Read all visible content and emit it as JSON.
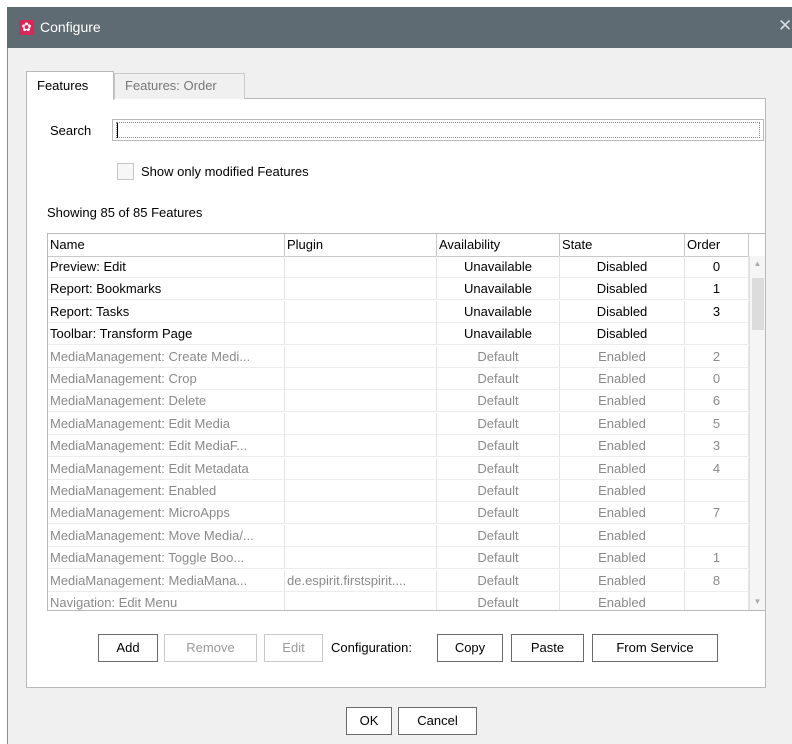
{
  "window": {
    "title": "Configure",
    "close_glyph": "✕"
  },
  "tabs": [
    {
      "label": "Features"
    },
    {
      "label": "Features: Order"
    }
  ],
  "search": {
    "label": "Search",
    "value": ""
  },
  "filter": {
    "label": "Show only modified Features",
    "checked": false
  },
  "status": "Showing 85 of 85 Features",
  "table": {
    "columns": [
      "Name",
      "Plugin",
      "Availability",
      "State",
      "Order"
    ],
    "rows": [
      {
        "name": "Preview: Edit",
        "plugin": "",
        "availability": "Unavailable",
        "state": "Disabled",
        "order": "0",
        "modified": true
      },
      {
        "name": "Report: Bookmarks",
        "plugin": "",
        "availability": "Unavailable",
        "state": "Disabled",
        "order": "1",
        "modified": true
      },
      {
        "name": "Report: Tasks",
        "plugin": "",
        "availability": "Unavailable",
        "state": "Disabled",
        "order": "3",
        "modified": true
      },
      {
        "name": "Toolbar: Transform Page",
        "plugin": "",
        "availability": "Unavailable",
        "state": "Disabled",
        "order": "",
        "modified": true
      },
      {
        "name": "MediaManagement: Create Medi...",
        "plugin": "",
        "availability": "Default",
        "state": "Enabled",
        "order": "2",
        "modified": false
      },
      {
        "name": "MediaManagement: Crop",
        "plugin": "",
        "availability": "Default",
        "state": "Enabled",
        "order": "0",
        "modified": false
      },
      {
        "name": "MediaManagement: Delete",
        "plugin": "",
        "availability": "Default",
        "state": "Enabled",
        "order": "6",
        "modified": false
      },
      {
        "name": "MediaManagement: Edit Media",
        "plugin": "",
        "availability": "Default",
        "state": "Enabled",
        "order": "5",
        "modified": false
      },
      {
        "name": "MediaManagement: Edit MediaF...",
        "plugin": "",
        "availability": "Default",
        "state": "Enabled",
        "order": "3",
        "modified": false
      },
      {
        "name": "MediaManagement: Edit Metadata",
        "plugin": "",
        "availability": "Default",
        "state": "Enabled",
        "order": "4",
        "modified": false
      },
      {
        "name": "MediaManagement: Enabled",
        "plugin": "",
        "availability": "Default",
        "state": "Enabled",
        "order": "",
        "modified": false
      },
      {
        "name": "MediaManagement: MicroApps",
        "plugin": "",
        "availability": "Default",
        "state": "Enabled",
        "order": "7",
        "modified": false
      },
      {
        "name": "MediaManagement: Move Media/...",
        "plugin": "",
        "availability": "Default",
        "state": "Enabled",
        "order": "",
        "modified": false
      },
      {
        "name": "MediaManagement: Toggle Boo...",
        "plugin": "",
        "availability": "Default",
        "state": "Enabled",
        "order": "1",
        "modified": false
      },
      {
        "name": "MediaManagement: MediaMana...",
        "plugin": "de.espirit.firstspirit....",
        "availability": "Default",
        "state": "Enabled",
        "order": "8",
        "modified": false
      },
      {
        "name": "Navigation: Edit Menu",
        "plugin": "",
        "availability": "Default",
        "state": "Enabled",
        "order": "",
        "modified": false
      }
    ]
  },
  "actions": {
    "add": "Add",
    "remove": "Remove",
    "edit": "Edit",
    "configuration_label": "Configuration:",
    "copy": "Copy",
    "paste": "Paste",
    "from_service": "From Service"
  },
  "dialog": {
    "ok": "OK",
    "cancel": "Cancel"
  },
  "icons": {
    "title": "gear-icon",
    "close": "close-icon"
  },
  "colors": {
    "titlebar": "#5f6b73",
    "app_icon": "#d6285a",
    "disabled_text": "#8a8a8a"
  }
}
